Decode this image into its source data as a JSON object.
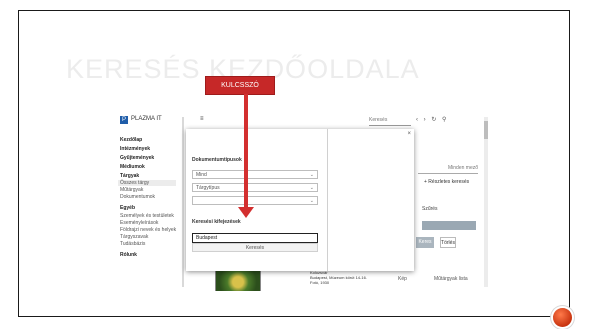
{
  "slide": {
    "title": "KERESÉS KEZDŐOLDALA",
    "callout_label": "KULCSSZÓ"
  },
  "app": {
    "brand_name": "PLAZMA IT",
    "menu_glyph": "≡",
    "top_search_placeholder": "Keresés",
    "top_icons": "‹ › ↻ ⚲",
    "sidebar": [
      {
        "label": "Kezdőlap",
        "kind": "head"
      },
      {
        "label": "Intézmények",
        "kind": "head"
      },
      {
        "label": "Gyűjtemények",
        "kind": "head"
      },
      {
        "label": "Médiumok",
        "kind": "head"
      },
      {
        "label": "Tárgyak",
        "kind": "head"
      },
      {
        "label": "Összes tárgy",
        "kind": "sel"
      },
      {
        "label": "Műtárgyak",
        "kind": "item"
      },
      {
        "label": "Dokumentumok",
        "kind": "item"
      },
      {
        "label": "Egyéb",
        "kind": "head"
      },
      {
        "label": "Személyek és testületek",
        "kind": "item"
      },
      {
        "label": "Eseményleírások",
        "kind": "item"
      },
      {
        "label": "Földrajzi nevek és helyek",
        "kind": "item"
      },
      {
        "label": "Tárgyszavak",
        "kind": "item"
      },
      {
        "label": "Tudásbázis",
        "kind": "item"
      },
      {
        "label": "Rólunk",
        "kind": "head"
      }
    ],
    "modal": {
      "close": "×",
      "section_label": "Dokumentumtípusok",
      "select_1": "Mind",
      "select_2": "Tárgytípus",
      "select_3": "",
      "keyword_label": "Keresési kifejezések",
      "keyword_value": "Budapest",
      "button_label": "Keresés"
    },
    "background": {
      "field_text": "Minden mező",
      "advanced_link": "+ Részletes keresés",
      "small_text": "Szűrés",
      "btn_primary": "Keres",
      "btn_secondary": "Törlés",
      "row_text": "Műtárgyak lista",
      "row_text_2": "Kép"
    },
    "result": {
      "title": "Kolozsvár",
      "line_1": "Budapest, Múzeum körút 14-16.",
      "line_2": "Fotó, 1930"
    }
  },
  "colors": {
    "callout_red": "#c62828",
    "arrow_red": "#d32f2f",
    "brand_blue": "#1f5da9",
    "title_gray": "#ececec"
  }
}
